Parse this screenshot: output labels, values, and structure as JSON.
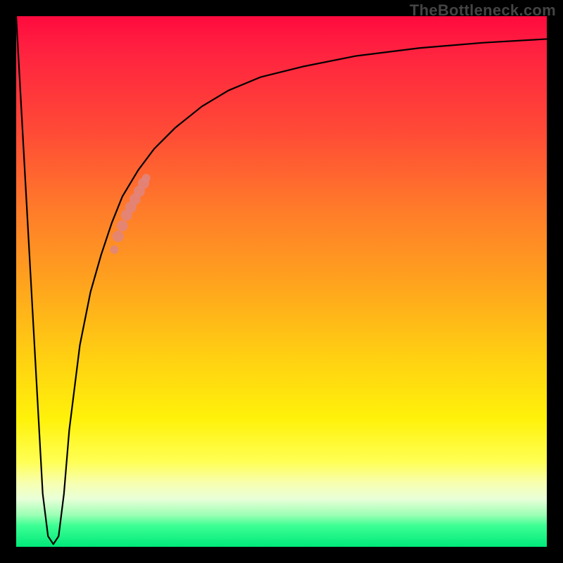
{
  "watermark": "TheBottleneck.com",
  "colors": {
    "frame": "#000000",
    "curve_stroke": "#000000",
    "marker_fill": "#e0857f",
    "gradient_top": "#ff0a3e",
    "gradient_bottom": "#00e97a"
  },
  "chart_data": {
    "type": "line",
    "title": "",
    "xlabel": "",
    "ylabel": "",
    "xlim": [
      0,
      100
    ],
    "ylim": [
      0,
      100
    ],
    "series": [
      {
        "name": "bottleneck-curve",
        "x": [
          0,
          2,
          4,
          5,
          6,
          7,
          8,
          9,
          10,
          12,
          14,
          16,
          18,
          20,
          23,
          26,
          30,
          35,
          40,
          46,
          54,
          64,
          76,
          88,
          100
        ],
        "y": [
          100,
          64,
          28,
          10,
          2,
          0.5,
          2,
          10,
          22,
          38,
          48,
          55,
          61,
          66,
          71,
          75,
          79,
          83,
          86,
          88.5,
          90.5,
          92.5,
          94,
          95,
          95.7
        ]
      }
    ],
    "markers": {
      "name": "highlighted-points",
      "x": [
        18.5,
        19.2,
        20.0,
        20.8,
        21.6,
        22.4,
        23.2,
        24.0,
        24.5
      ],
      "y": [
        56.0,
        58.5,
        60.5,
        62.5,
        64.0,
        65.5,
        67.0,
        68.5,
        69.5
      ]
    },
    "background": {
      "type": "vertical-gradient",
      "meaning": "red=high bottleneck, green=low bottleneck"
    }
  }
}
